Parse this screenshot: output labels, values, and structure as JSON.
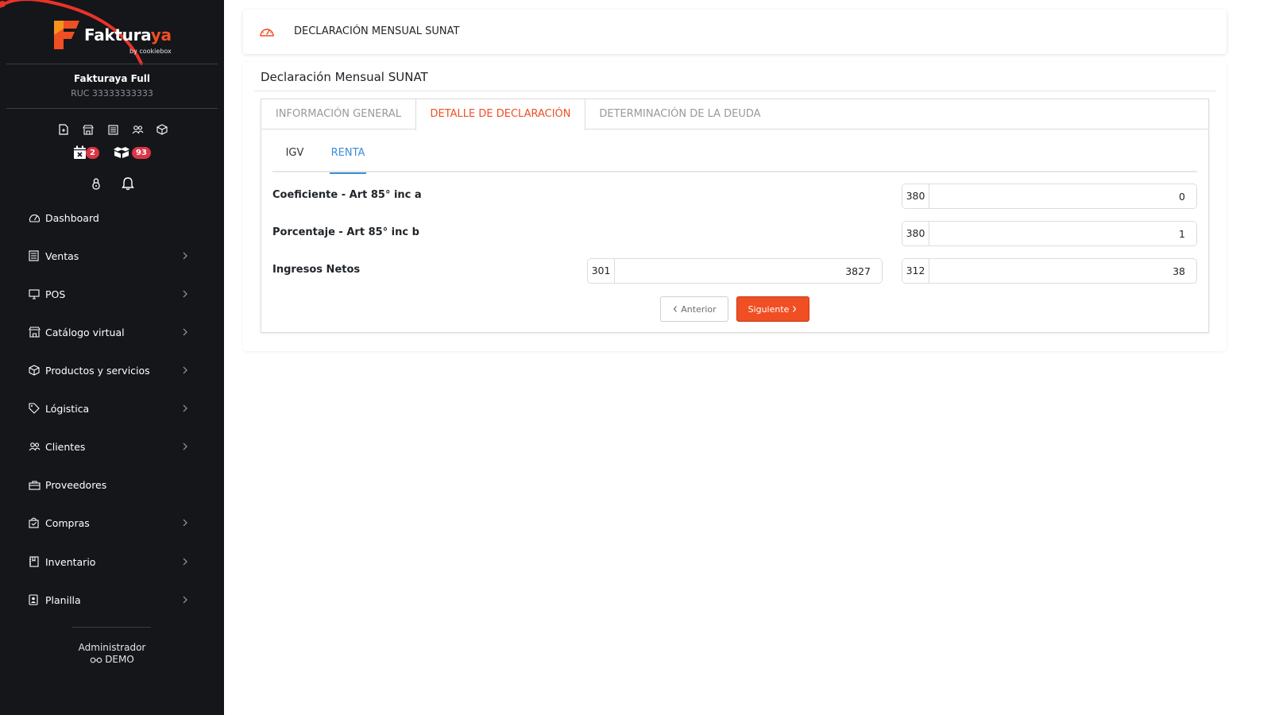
{
  "brand": {
    "logo_text_part1": "Faktura",
    "logo_text_part2": "ya",
    "logo_sub": "by cookiebox",
    "accent_color": "#f04e23"
  },
  "company": {
    "name": "Fakturaya Full",
    "ruc": "RUC 33333333333"
  },
  "quick_icons": [
    "file-icon",
    "store-icon",
    "receipt-icon",
    "users-icon",
    "box-icon"
  ],
  "badges": [
    {
      "icon": "calendar-x-icon",
      "count": "2"
    },
    {
      "icon": "boxes-icon",
      "count": "93"
    }
  ],
  "user_icons": [
    "lock-icon",
    "bell-icon"
  ],
  "menu": [
    {
      "label": "Dashboard",
      "icon": "dashboard-icon",
      "has_children": false
    },
    {
      "label": "Ventas",
      "icon": "ventas-icon",
      "has_children": true
    },
    {
      "label": "POS",
      "icon": "monitor-icon",
      "has_children": true
    },
    {
      "label": "Catálogo virtual",
      "icon": "store-icon",
      "has_children": true
    },
    {
      "label": "Productos y servicios",
      "icon": "box-icon",
      "has_children": true
    },
    {
      "label": "Lógistica",
      "icon": "tag-icon",
      "has_children": true
    },
    {
      "label": "Clientes",
      "icon": "users-icon",
      "has_children": true
    },
    {
      "label": "Proveedores",
      "icon": "briefcase-icon",
      "has_children": false
    },
    {
      "label": "Compras",
      "icon": "bag-icon",
      "has_children": true
    },
    {
      "label": "Inventario",
      "icon": "inventory-icon",
      "has_children": true
    },
    {
      "label": "Planilla",
      "icon": "badge-icon",
      "has_children": true
    }
  ],
  "footer": {
    "role": "Administrador",
    "user": "DEMO"
  },
  "header": {
    "icon": "speedometer-icon",
    "title": "DECLARACIÓN MENSUAL SUNAT"
  },
  "main": {
    "section_title": "Declaración Mensual SUNAT",
    "tabs": [
      {
        "label": "INFORMACIÓN GENERAL",
        "active": false
      },
      {
        "label": "DETALLE DE DECLARACIÓN",
        "active": true
      },
      {
        "label": "DETERMINACIÓN DE LA DEUDA",
        "active": false
      }
    ],
    "subtabs": [
      {
        "label": "IGV",
        "active": false
      },
      {
        "label": "RENTA",
        "active": true
      }
    ],
    "rows": [
      {
        "label": "Coeficiente - Art 85° inc a",
        "fields": [
          {
            "prefix": "380",
            "value": "0"
          }
        ]
      },
      {
        "label": "Porcentaje - Art 85° inc b",
        "fields": [
          {
            "prefix": "380",
            "value": "1"
          }
        ]
      },
      {
        "label": "Ingresos Netos",
        "fields": [
          {
            "prefix": "301",
            "value": "3827"
          },
          {
            "prefix": "312",
            "value": "38"
          }
        ]
      }
    ],
    "buttons": {
      "prev_label": "Anterior",
      "next_label": "Siguiente"
    },
    "active_tab_color": "#f04e23",
    "active_subtab_color": "#3a8fd8"
  }
}
